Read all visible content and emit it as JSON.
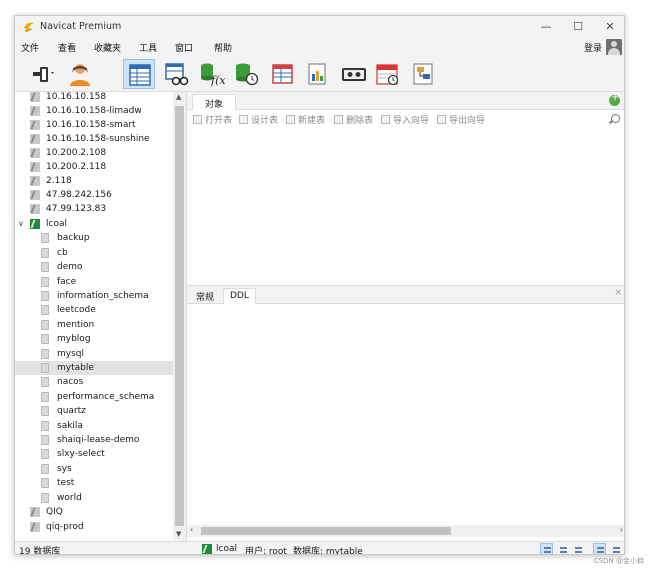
{
  "app": {
    "title": "Navicat Premium"
  },
  "window_controls": {
    "minimize": "—",
    "maximize": "☐",
    "close": "✕"
  },
  "menu": [
    "文件",
    "查看",
    "收藏夹",
    "工具",
    "窗口",
    "帮助"
  ],
  "login_label": "登录",
  "toolbar_icons": [
    "connection-icon",
    "user-icon",
    "table-icon",
    "view-icon",
    "function-icon",
    "event-icon",
    "query-icon",
    "report-icon",
    "backup-icon",
    "schedule-icon",
    "model-icon"
  ],
  "connections_above": [
    "10.16.10.158",
    "10.16.10.158-limadw",
    "10.16.10.158-smart",
    "10.16.10.158-sunshine",
    "10.200.2.108",
    "10.200.2.118",
    "2.118",
    "47.98.242.156",
    "47.99.123.83"
  ],
  "active_connection": {
    "name": "lcoal",
    "expander": "∨"
  },
  "databases": [
    "backup",
    "cb",
    "demo",
    "face",
    "information_schema",
    "leetcode",
    "mention",
    "myblog",
    "mysql",
    "mytable",
    "nacos",
    "performance_schema",
    "quartz",
    "sakila",
    "shaiqi-lease-demo",
    "slxy-select",
    "sys",
    "test",
    "world"
  ],
  "selected_database": "mytable",
  "connections_below": [
    "QIQ",
    "qiq-prod"
  ],
  "object_tab": "对象",
  "object_toolbar": [
    "打开表",
    "设计表",
    "新建表",
    "删除表",
    "导入向导",
    "导出向导"
  ],
  "ddl_tabs": [
    "常规",
    "DDL"
  ],
  "ddl_active_tab": "DDL",
  "ddl_close": "×",
  "status": {
    "count": "19 数据库",
    "connection": "lcoal",
    "user": "用户: root",
    "database": "数据库: mytable"
  },
  "watermark": "CSDN @金小韩"
}
